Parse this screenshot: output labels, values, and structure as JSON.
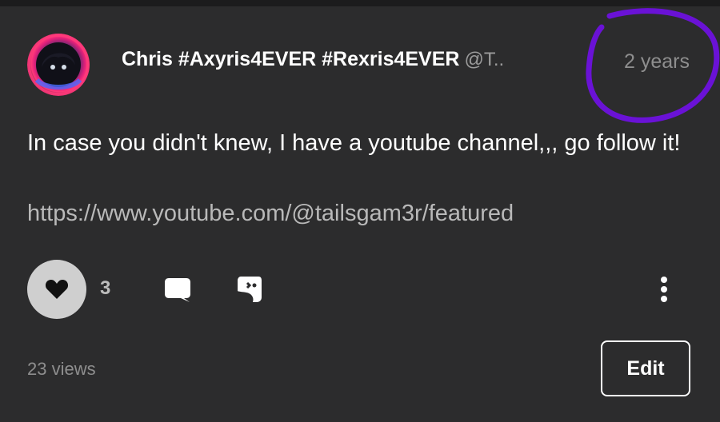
{
  "post": {
    "author_name": "Chris #Axyris4EVER #Rexris4EVER",
    "author_handle": "@T..",
    "time_ago": "2 years",
    "body_text": "In case you didn't knew, I have a youtube channel,,, go follow it!",
    "link_text": "https://www.youtube.com/@tailsgam3r/featured",
    "like_count": "3",
    "views_text": "23 views",
    "edit_label": "Edit"
  },
  "icons": {
    "like": "heart-icon",
    "comment": "comment-bubble-icon",
    "share": "share-icon",
    "more": "more-vertical-icon",
    "avatar": "user-avatar"
  },
  "colors": {
    "background": "#2c2c2d",
    "highlight_circle": "#6a12d6",
    "avatar_ring": "#ff2a7a"
  }
}
